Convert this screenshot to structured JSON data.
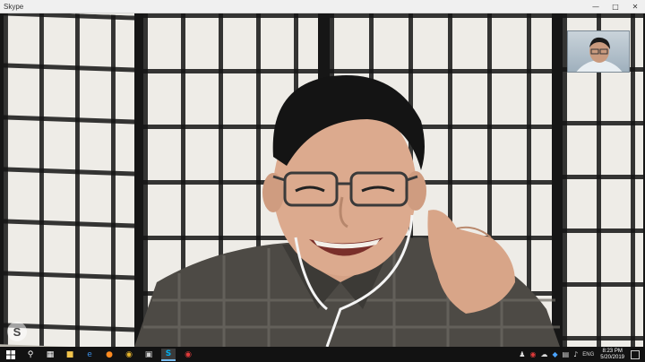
{
  "window": {
    "title": "Skype"
  },
  "icons": {
    "minimize": "minimize-icon",
    "maximize": "maximize-icon",
    "close": "close-icon",
    "skype_badge": "skype-logo-icon",
    "start": "windows-start-icon",
    "search": "search-icon",
    "task_view": "task-view-icon",
    "file_explorer": "file-explorer-icon",
    "edge": "edge-browser-icon",
    "firefox": "firefox-icon",
    "chrome": "chrome-icon",
    "store": "store-icon",
    "skype": "skype-taskbar-icon",
    "record": "record-icon"
  },
  "taskbar": {
    "language": "ENG",
    "time": "8:23 PM",
    "date": "5/20/2019"
  },
  "colors": {
    "titlebar": "#f0f0f0",
    "taskbar": "#121212",
    "accent": "#76b9ed"
  }
}
